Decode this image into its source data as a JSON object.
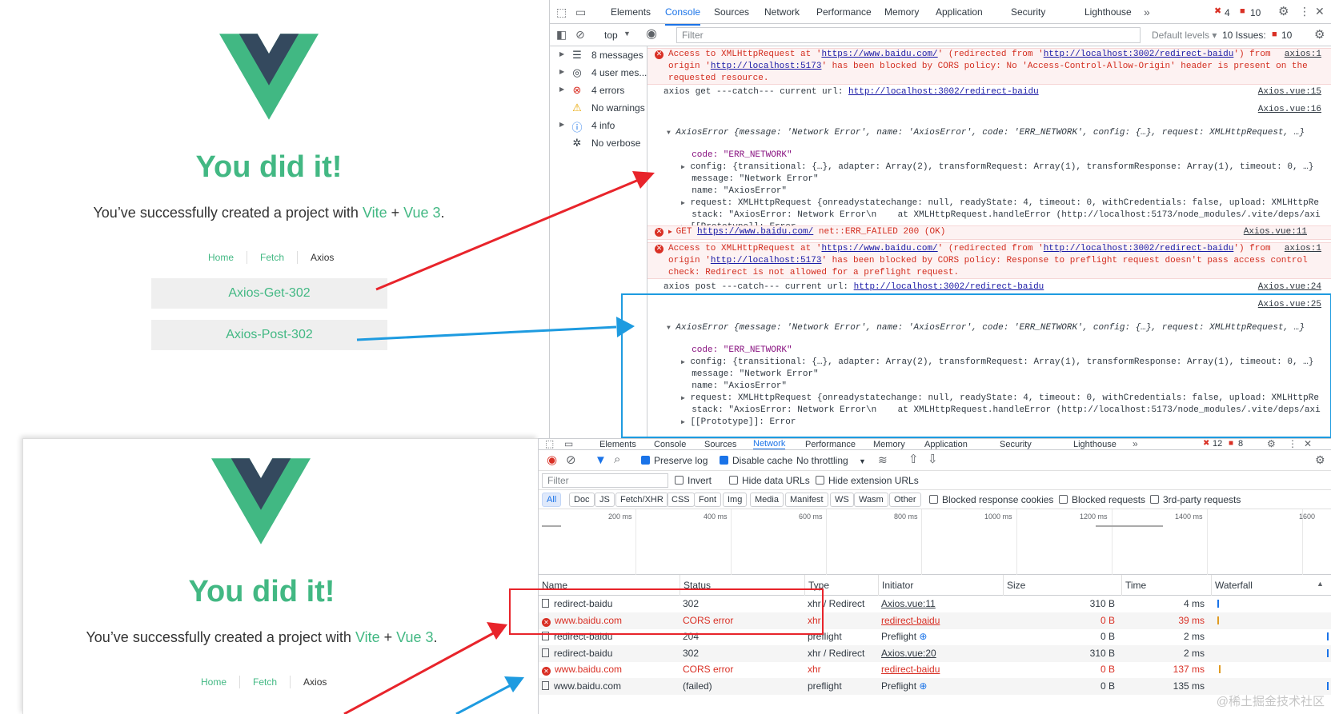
{
  "vue": {
    "title": "You did it!",
    "subtitle_prefix": "You’ve successfully created a project with ",
    "vite": "Vite",
    "plus": " + ",
    "vue3": "Vue 3",
    "period": ".",
    "nav": [
      "Home",
      "Fetch",
      "Axios"
    ],
    "btn_get": "Axios-Get-302",
    "btn_post": "Axios-Post-302"
  },
  "devtools_tabs": [
    "Elements",
    "Console",
    "Sources",
    "Network",
    "Performance",
    "Memory",
    "Application",
    "Security",
    "Lighthouse"
  ],
  "console": {
    "error_count": "4",
    "warn_count": "10",
    "context": "top",
    "filter_placeholder": "Filter",
    "default_levels": "Default levels ▾",
    "issues_label": "10 Issues:",
    "issues_count": "10",
    "sidebar": [
      {
        "label": "8 messages"
      },
      {
        "label": "4 user mes..."
      },
      {
        "label": "4 errors"
      },
      {
        "label": "No warnings"
      },
      {
        "label": "4 info"
      },
      {
        "label": "No verbose"
      }
    ],
    "err1": {
      "a": "Access to XMLHttpRequest at '",
      "url1": "https://www.baidu.com/",
      "b": "' (redirected from '",
      "url2": "http://localhost:3002/redirect-baidu",
      "c": "') from",
      "line2a": "origin '",
      "url3": "http://localhost:5173",
      "line2b": "' has been blocked by CORS policy: No 'Access-Control-Allow-Origin' header is present on the",
      "line3": "requested resource.",
      "src": "axios:1"
    },
    "log1": {
      "text": "axios get ---catch--- current url: ",
      "url": "http://localhost:3002/redirect-baidu",
      "src": "Axios.vue:15"
    },
    "src16": "Axios.vue:16",
    "axios_error_head": "AxiosError {message: 'Network Error', name: 'AxiosError', code: 'ERR_NETWORK', config: {…}, request: XMLHttpRequest, …}",
    "props": {
      "code": "code: \"ERR_NETWORK\"",
      "config": "config: {transitional: {…}, adapter: Array(2), transformRequest: Array(1), transformResponse: Array(1), timeout: 0, …}",
      "message": "message: \"Network Error\"",
      "name": "name: \"AxiosError\"",
      "request": "request: XMLHttpRequest {onreadystatechange: null, readyState: 4, timeout: 0, withCredentials: false, upload: XMLHttpRe",
      "stack": "stack: \"AxiosError: Network Error\\n    at XMLHttpRequest.handleError (http://localhost:5173/node_modules/.vite/deps/axi",
      "proto": "[[Prototype]]: Error"
    },
    "err_get": {
      "a": "GET ",
      "url": "https://www.baidu.com/",
      "b": " net::ERR_FAILED 200 (OK)",
      "src": "Axios.vue:11"
    },
    "err2": {
      "a": "Access to XMLHttpRequest at '",
      "url1": "https://www.baidu.com/",
      "b": "' (redirected from '",
      "url2": "http://localhost:3002/redirect-baidu",
      "c": "') from",
      "line2a": "origin '",
      "url3": "http://localhost:5173",
      "line2b": "' has been blocked by CORS policy: Response to preflight request doesn't pass access control",
      "line3": "check: Redirect is not allowed for a preflight request.",
      "src": "axios:1"
    },
    "log2": {
      "text": "axios post ---catch--- current url: ",
      "url": "http://localhost:3002/redirect-baidu",
      "src": "Axios.vue:24"
    },
    "src25": "Axios.vue:25"
  },
  "network": {
    "error_count": "12",
    "warn_count": "8",
    "preserve_log": "Preserve log",
    "disable_cache": "Disable cache",
    "throttling": "No throttling",
    "filter_placeholder": "Filter",
    "invert": "Invert",
    "hide_data_urls": "Hide data URLs",
    "hide_ext_urls": "Hide extension URLs",
    "types": [
      "All",
      "Doc",
      "JS",
      "Fetch/XHR",
      "CSS",
      "Font",
      "Img",
      "Media",
      "Manifest",
      "WS",
      "Wasm",
      "Other"
    ],
    "blocked_cookies": "Blocked response cookies",
    "blocked_requests": "Blocked requests",
    "third_party": "3rd-party requests",
    "ticks": [
      "200 ms",
      "400 ms",
      "600 ms",
      "800 ms",
      "1000 ms",
      "1200 ms",
      "1400 ms",
      "1600"
    ],
    "columns": [
      "Name",
      "Status",
      "Type",
      "Initiator",
      "Size",
      "Time",
      "Waterfall"
    ],
    "rows": [
      {
        "name": "redirect-baidu",
        "status": "302",
        "type": "xhr / Redirect",
        "initiator": "Axios.vue:11",
        "size": "310 B",
        "time": "4 ms",
        "error": false
      },
      {
        "name": "www.baidu.com",
        "status": "CORS error",
        "type": "xhr",
        "initiator": "redirect-baidu",
        "size": "0 B",
        "time": "39 ms",
        "error": true
      },
      {
        "name": "redirect-baidu",
        "status": "204",
        "type": "preflight",
        "initiator": "Preflight",
        "size": "0 B",
        "time": "2 ms",
        "error": false
      },
      {
        "name": "redirect-baidu",
        "status": "302",
        "type": "xhr / Redirect",
        "initiator": "Axios.vue:20",
        "size": "310 B",
        "time": "2 ms",
        "error": false
      },
      {
        "name": "www.baidu.com",
        "status": "CORS error",
        "type": "xhr",
        "initiator": "redirect-baidu",
        "size": "0 B",
        "time": "137 ms",
        "error": true
      },
      {
        "name": "www.baidu.com",
        "status": "(failed)",
        "type": "preflight",
        "initiator": "Preflight",
        "size": "0 B",
        "time": "135 ms",
        "error": false
      }
    ]
  },
  "watermark": "@稀土掘金技术社区",
  "colors": {
    "vue_green": "#42b883",
    "vue_dark": "#35495e",
    "red_arrow": "#e8242b",
    "blue_arrow": "#1e9be0",
    "error": "#d93025",
    "accent": "#1a73e8"
  }
}
